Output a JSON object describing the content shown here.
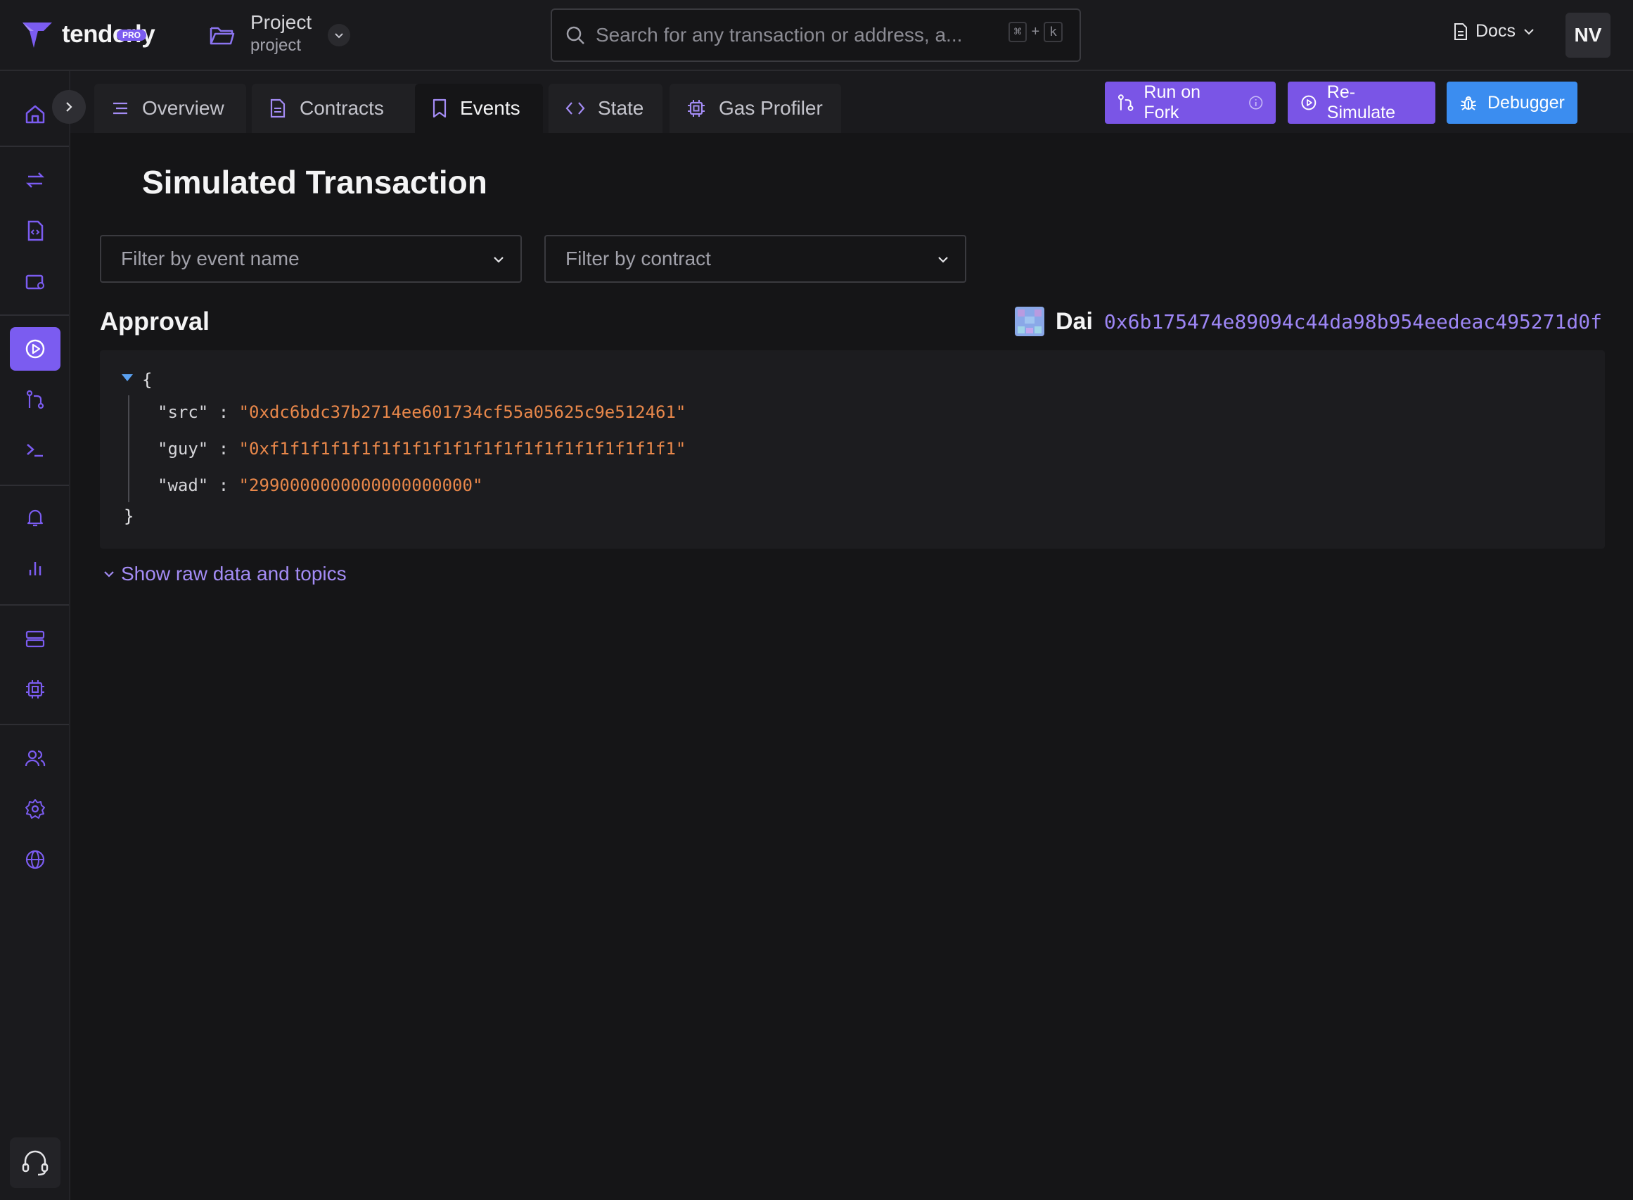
{
  "app": {
    "logo_text": "tenderly",
    "plan_badge": "PRO"
  },
  "project": {
    "name": "Project",
    "slug": "project"
  },
  "search": {
    "placeholder": "Search for any transaction or address, a...",
    "shortcut_mod": "⌘",
    "shortcut_plus": "+",
    "shortcut_key": "k"
  },
  "header": {
    "docs_label": "Docs",
    "avatar_initials": "NV"
  },
  "tabs": [
    {
      "label": "Overview",
      "icon": "list-icon"
    },
    {
      "label": "Contracts",
      "icon": "document-icon"
    },
    {
      "label": "Events",
      "icon": "bookmark-icon",
      "active": true
    },
    {
      "label": "State",
      "icon": "code-icon"
    },
    {
      "label": "Gas Profiler",
      "icon": "chip-icon"
    }
  ],
  "actions": {
    "run_on_fork": "Run on Fork",
    "re_simulate": "Re-Simulate",
    "debugger": "Debugger"
  },
  "page": {
    "title": "Simulated Transaction"
  },
  "filters": {
    "event_name_placeholder": "Filter by event name",
    "contract_placeholder": "Filter by contract"
  },
  "event": {
    "name": "Approval",
    "contract_name": "Dai",
    "contract_address": "0x6b175474e89094c44da98b954eedeac495271d0f",
    "open_brace": "{",
    "close_brace": "}",
    "params": [
      {
        "key": "\"src\"",
        "sep": " : ",
        "value": "\"0xdc6bdc37b2714ee601734cf55a05625c9e512461\""
      },
      {
        "key": "\"guy\"",
        "sep": " : ",
        "value": "\"0xf1f1f1f1f1f1f1f1f1f1f1f1f1f1f1f1f1f1f1f1\""
      },
      {
        "key": "\"wad\"",
        "sep": " : ",
        "value": "\"2990000000000000000000\""
      }
    ],
    "raw_toggle": "Show raw data and topics"
  },
  "colors": {
    "accent": "#7a55e6",
    "debugger": "#3b8df0",
    "json_value": "#e8874a",
    "link": "#a48cf5"
  }
}
